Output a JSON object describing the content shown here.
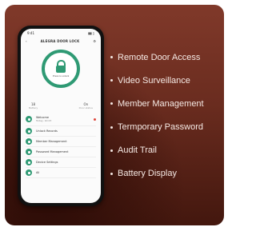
{
  "phone": {
    "status_time": "9:41",
    "status_icons": "▮▮ ▯",
    "app_title": "ALEGRA DOOR LOCK",
    "ring_label": "Press to unlock",
    "stats": [
      {
        "value": "18",
        "label": "Battery"
      },
      {
        "value": "On",
        "label": "Door status"
      }
    ],
    "list": [
      {
        "label": "Welcome",
        "sub": "Today, 10:23"
      },
      {
        "label": "Unlock Records"
      },
      {
        "label": "Member Management"
      },
      {
        "label": "Password Management"
      },
      {
        "label": "Device Settings"
      },
      {
        "label": "All"
      }
    ]
  },
  "features": [
    "Remote Door Access",
    "Video Surveillance",
    "Member Management",
    "Termporary Password",
    "Audit Trail",
    "Battery Display"
  ],
  "colors": {
    "accent": "#2f9a74",
    "card_bg": "#6a2c1f",
    "text": "#f5e9e4"
  }
}
